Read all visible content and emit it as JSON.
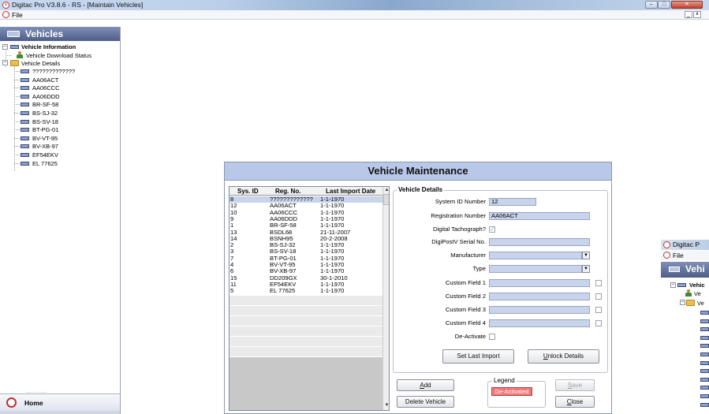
{
  "window": {
    "title": "Digitac Pro V3.8.6 - RS - [Maintain Vehicles]",
    "controls": {
      "minimize": "–",
      "maximize": "□",
      "close": "✕"
    }
  },
  "menubar": {
    "file": "File",
    "mdi_minimize": "_",
    "mdi_restore": "ᴕ"
  },
  "nav": {
    "header": "Vehicles",
    "tree": {
      "root": "Vehicle Information",
      "download_status": "Vehicle Download Status",
      "details": "Vehicle Details",
      "vehicles": [
        "?????????????",
        "AA06ACT",
        "AA06CCC",
        "AA06DDD",
        "BR-SF-58",
        "BS-SJ-32",
        "BS-SV-18",
        "BT-PG-01",
        "BV-VT-95",
        "BV-XB-97",
        "EF54EKV",
        "EL 77625"
      ]
    },
    "dots": "..........",
    "home": "Home"
  },
  "dialog": {
    "title": "Vehicle Maintenance",
    "grid": {
      "headers": {
        "sys_id": "Sys. ID",
        "reg_no": "Reg. No.",
        "last_import": "Last Import Date"
      },
      "rows": [
        {
          "id": "8",
          "reg": "?????????????",
          "date": "1-1-1970"
        },
        {
          "id": "12",
          "reg": "AA06ACT",
          "date": "1-1-1970"
        },
        {
          "id": "10",
          "reg": "AA06CCC",
          "date": "1-1-1970"
        },
        {
          "id": "9",
          "reg": "AA06DDD",
          "date": "1-1-1970"
        },
        {
          "id": "1",
          "reg": "BR-SF-58",
          "date": "1-1-1970"
        },
        {
          "id": "13",
          "reg": "BSDL68",
          "date": "21-11-2007"
        },
        {
          "id": "14",
          "reg": "BSNH95",
          "date": "20-2-2008"
        },
        {
          "id": "2",
          "reg": "BS-SJ-32",
          "date": "1-1-1970"
        },
        {
          "id": "3",
          "reg": "BS-SV-18",
          "date": "1-1-1970"
        },
        {
          "id": "7",
          "reg": "BT-PG-01",
          "date": "1-1-1970"
        },
        {
          "id": "4",
          "reg": "BV-VT-95",
          "date": "1-1-1970"
        },
        {
          "id": "6",
          "reg": "BV-XB-97",
          "date": "1-1-1970"
        },
        {
          "id": "15",
          "reg": "DD209GX",
          "date": "30-1-2010"
        },
        {
          "id": "11",
          "reg": "EF54EKV",
          "date": "1-1-1970"
        },
        {
          "id": "5",
          "reg": "EL 77625",
          "date": "1-1-1970"
        }
      ],
      "scroll_up": "▲",
      "scroll_down": "▼"
    },
    "details": {
      "legend": "Vehicle Details",
      "system_id_label": "System ID Number",
      "system_id_value": "12",
      "reg_label": "Registration Number",
      "reg_value": "AA06ACT",
      "digital_tacho_label": "Digital Tachograph?",
      "digipostv_label": "DigiPostV Serial No.",
      "digipostv_value": "",
      "manufacturer_label": "Manufacturer",
      "manufacturer_value": "",
      "type_label": "Type",
      "type_value": "",
      "custom1_label": "Custom Field 1",
      "custom2_label": "Custom Field 2",
      "custom3_label": "Custom Field 3",
      "custom4_label": "Custom Field 4",
      "deactivate_label": "De-Activate",
      "set_last_import": "Set Last Import",
      "unlock_details_u": "U",
      "unlock_details_rest": "nlock Details"
    },
    "buttons": {
      "add_u": "A",
      "add_rest": "dd",
      "delete": "Delete Vehicle",
      "save_u": "S",
      "save_rest": "ave",
      "close_u": "C",
      "close_rest": "lose"
    },
    "legend": {
      "title": "Legend",
      "deactivated": "De-Activated"
    },
    "colors": {
      "selected_row": "#c8d4ec",
      "input_bg": "#c8d4ec",
      "deactivated": "#f07878"
    }
  },
  "secondary_window": {
    "title": "Digitac P",
    "file": "File",
    "header": "Vehi",
    "tree_root": "Vehic",
    "tree_item1": "Ve",
    "tree_item2": "Ve"
  },
  "icons": [
    "app-clock-icon",
    "vehicle-icon",
    "person-icon",
    "folder-icon",
    "home-icon",
    "dropdown-arrow-icon",
    "checkbox-icon"
  ]
}
